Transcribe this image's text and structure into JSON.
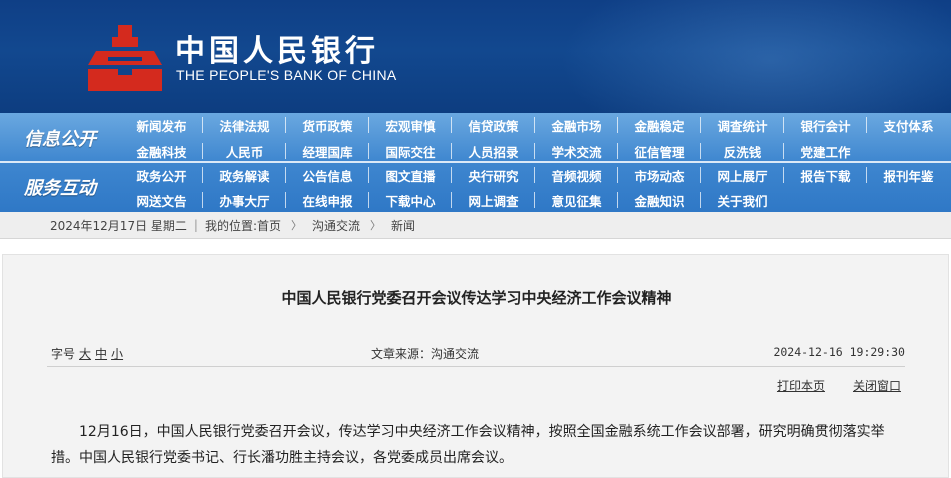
{
  "header": {
    "bank_name_cn": "中国人民银行",
    "bank_name_en": "THE PEOPLE'S BANK OF CHINA",
    "logo_icon": "pboc-logo-icon",
    "colors": {
      "banner": "#12488f",
      "logo": "#d42a1e",
      "nav": "#3e86cf"
    }
  },
  "nav": {
    "section1_label": "信息公开",
    "section2_label": "服务互动",
    "rows": [
      [
        "新闻发布",
        "法律法规",
        "货币政策",
        "宏观审慎",
        "信贷政策",
        "金融市场",
        "金融稳定",
        "调查统计",
        "银行会计",
        "支付体系"
      ],
      [
        "金融科技",
        "人民币",
        "经理国库",
        "国际交往",
        "人员招录",
        "学术交流",
        "征信管理",
        "反洗钱",
        "党建工作"
      ],
      [
        "政务公开",
        "政务解读",
        "公告信息",
        "图文直播",
        "央行研究",
        "音频视频",
        "市场动态",
        "网上展厅",
        "报告下载",
        "报刊年鉴"
      ],
      [
        "网送文告",
        "办事大厅",
        "在线申报",
        "下载中心",
        "网上调查",
        "意见征集",
        "金融知识",
        "关于我们"
      ]
    ]
  },
  "breadcrumb": {
    "date": "2024年12月17日 星期二",
    "location_label": "我的位置:",
    "home": "首页",
    "level1": "沟通交流",
    "level2": "新闻",
    "separator": "|",
    "arrow": "〉"
  },
  "article": {
    "title": "中国人民银行党委召开会议传达学习中央经济工作会议精神",
    "font_size_label": "字号",
    "font_large": "大",
    "font_medium": "中",
    "font_small": "小",
    "source": "文章来源：沟通交流",
    "datetime": "2024-12-16 19:29:30",
    "print_label": "打印本页",
    "close_label": "关闭窗口",
    "body": "12月16日，中国人民银行党委召开会议，传达学习中央经济工作会议精神，按照全国金融系统工作会议部署，研究明确贯彻落实举措。中国人民银行党委书记、行长潘功胜主持会议，各党委成员出席会议。"
  }
}
